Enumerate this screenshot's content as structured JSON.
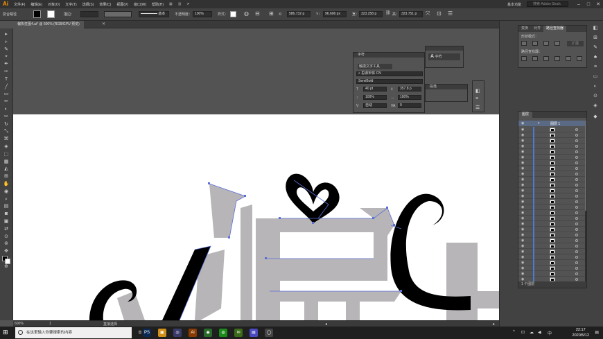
{
  "app": {
    "logo": "Ai",
    "menu": [
      "文件(F)",
      "编辑(E)",
      "对象(O)",
      "文字(T)",
      "选择(S)",
      "效果(C)",
      "视图(V)",
      "窗口(W)",
      "帮助(H)"
    ],
    "workspace": "基本功能",
    "search_placeholder": "搜索 Adobe Stock",
    "window_controls": [
      "–",
      "□",
      "✕"
    ]
  },
  "control_bar": {
    "selection_label": "复合路径",
    "stroke_label": "描边：",
    "stroke_style": "基本",
    "opacity_label": "不透明度：",
    "opacity_value": "100%",
    "style_label": "样式：",
    "x_label": "X：",
    "x_value": "586.732 p",
    "y_label": "Y：",
    "y_value": "96.606 px",
    "w_label": "宽：",
    "w_value": "323.258 p",
    "h_label": "高：",
    "h_value": "323.751 p"
  },
  "document": {
    "tab_title": "偏执狂图4.ai* @ 600% (RGB/GPU 预览)",
    "close": "✕"
  },
  "tools": [
    "▸",
    "▹",
    "✎",
    "⌖",
    "✒",
    "✑",
    "T",
    "╱",
    "▭",
    "✏",
    "◐",
    "✂",
    "↻",
    "⤡",
    "⌘",
    "◈",
    "⬚",
    "▦",
    "◭",
    "⊞",
    "✋",
    "◉",
    "⌕",
    "▤",
    "◙",
    "▣",
    "⇄",
    "⊙",
    "⊚",
    "✥",
    "⚲",
    "⊕"
  ],
  "character_panel": {
    "title": "字符",
    "touch_tool": "触摸文字工具",
    "font_family": "思源宋体 CN",
    "font_style": "SemiBold",
    "size": "40 pt",
    "leading": "357.8 p",
    "scale_v": "100%",
    "scale_h": "100%",
    "tracking_auto": "自动",
    "tracking": "0"
  },
  "mini_panel": {
    "title": "字符",
    "icon": "A"
  },
  "paragraph_panel": {
    "title": "段落"
  },
  "pathfinder": {
    "tabs": [
      "变换",
      "对齐",
      "路径查找器"
    ],
    "shape_modes_label": "形状模式：",
    "expand_label": "扩展",
    "pathfinder_label": "路径查找器："
  },
  "layers": {
    "tab": "图层",
    "top_layer": "图层 1",
    "footer": "1 个图层",
    "row_count": 28
  },
  "status": {
    "zoom": "600%",
    "page": "1",
    "tool": "直接选择"
  },
  "taskbar": {
    "search_text": "在这里输入你要搜索的内容",
    "time": "22:17",
    "date": "2020/5/12",
    "apps": [
      {
        "label": "PS",
        "color": "#0a2a55"
      },
      {
        "label": "▣",
        "color": "#d08f1a"
      },
      {
        "label": "◎",
        "color": "#3a3a6a"
      },
      {
        "label": "Ai",
        "color": "#8a3a00"
      },
      {
        "label": "◉",
        "color": "#2a6a2a"
      },
      {
        "label": "◍",
        "color": "#1a8a1a"
      },
      {
        "label": "✉",
        "color": "#3a6a1a"
      },
      {
        "label": "▤",
        "color": "#4a4ac0"
      },
      {
        "label": "◯",
        "color": "#444444"
      }
    ],
    "tray": [
      "^",
      "⊡",
      "☁",
      "◀",
      "中"
    ]
  }
}
